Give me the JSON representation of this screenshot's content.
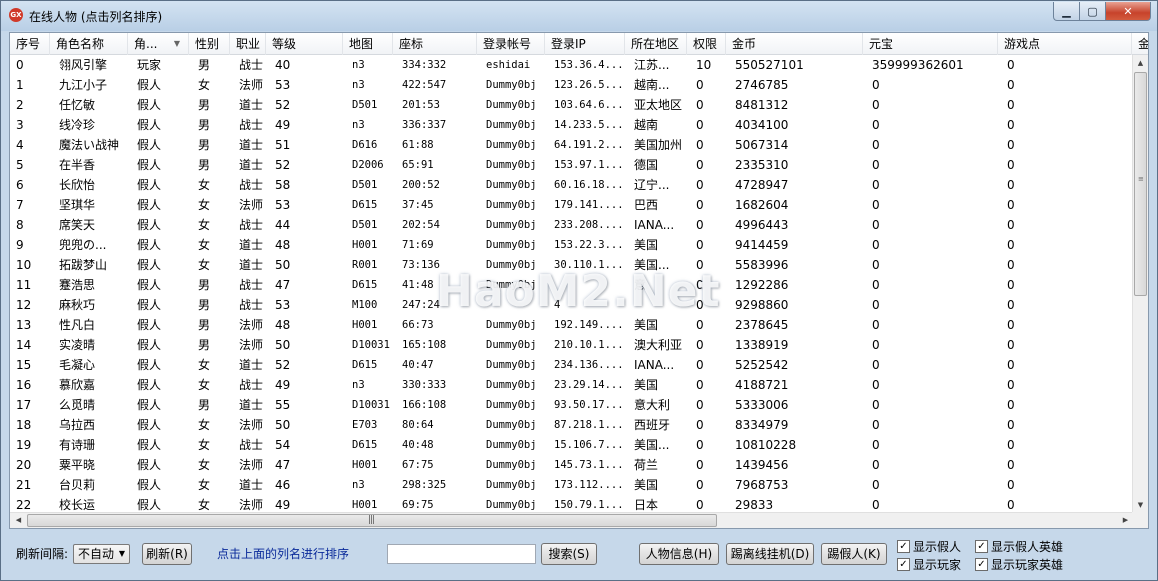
{
  "window": {
    "title": "在线人物 (点击列名排序)"
  },
  "columns": [
    {
      "key": "idx",
      "label": "序号"
    },
    {
      "key": "name",
      "label": "角色名称"
    },
    {
      "key": "role",
      "label": "角..."
    },
    {
      "key": "gender",
      "label": "性别"
    },
    {
      "key": "job",
      "label": "职业"
    },
    {
      "key": "level",
      "label": "等级"
    },
    {
      "key": "map",
      "label": "地图"
    },
    {
      "key": "coord",
      "label": "座标"
    },
    {
      "key": "account",
      "label": "登录帐号"
    },
    {
      "key": "ip",
      "label": "登录IP"
    },
    {
      "key": "region",
      "label": "所在地区"
    },
    {
      "key": "perm",
      "label": "权限"
    },
    {
      "key": "gold",
      "label": "金币"
    },
    {
      "key": "yuanbao",
      "label": "元宝"
    },
    {
      "key": "points",
      "label": "游戏点"
    },
    {
      "key": "more",
      "label": "金币"
    }
  ],
  "rows": [
    [
      "0",
      "翎风引擎",
      "玩家",
      "男",
      "战士",
      "40",
      "n3",
      "334:332",
      "eshidai",
      "153.36.4...",
      "江苏...",
      "10",
      "550527101",
      "359999362601",
      "0"
    ],
    [
      "1",
      "九江小子",
      "假人",
      "女",
      "法师",
      "53",
      "n3",
      "422:547",
      "Dummy0bj",
      "123.26.5...",
      "越南...",
      "0",
      "2746785",
      "0",
      "0"
    ],
    [
      "2",
      "任忆敏",
      "假人",
      "男",
      "道士",
      "52",
      "D501",
      "201:53",
      "Dummy0bj",
      "103.64.6...",
      "亚太地区",
      "0",
      "8481312",
      "0",
      "0"
    ],
    [
      "3",
      "线冷珍",
      "假人",
      "男",
      "战士",
      "49",
      "n3",
      "336:337",
      "Dummy0bj",
      "14.233.5...",
      "越南",
      "0",
      "4034100",
      "0",
      "0"
    ],
    [
      "4",
      "魔法い战神",
      "假人",
      "男",
      "道士",
      "51",
      "D616",
      "61:88",
      "Dummy0bj",
      "64.191.2...",
      "美国加州",
      "0",
      "5067314",
      "0",
      "0"
    ],
    [
      "5",
      "在半香",
      "假人",
      "男",
      "道士",
      "52",
      "D2006",
      "65:91",
      "Dummy0bj",
      "153.97.1...",
      "德国",
      "0",
      "2335310",
      "0",
      "0"
    ],
    [
      "6",
      "长欣怡",
      "假人",
      "女",
      "战士",
      "58",
      "D501",
      "200:52",
      "Dummy0bj",
      "60.16.18...",
      "辽宁...",
      "0",
      "4728947",
      "0",
      "0"
    ],
    [
      "7",
      "坚琪华",
      "假人",
      "女",
      "法师",
      "53",
      "D615",
      "37:45",
      "Dummy0bj",
      "179.141....",
      "巴西",
      "0",
      "1682604",
      "0",
      "0"
    ],
    [
      "8",
      "席笑天",
      "假人",
      "女",
      "战士",
      "44",
      "D501",
      "202:54",
      "Dummy0bj",
      "233.208....",
      "IANA...",
      "0",
      "4996443",
      "0",
      "0"
    ],
    [
      "9",
      "兜兜の...",
      "假人",
      "女",
      "道士",
      "48",
      "H001",
      "71:69",
      "Dummy0bj",
      "153.22.3...",
      "美国",
      "0",
      "9414459",
      "0",
      "0"
    ],
    [
      "10",
      "拓跋梦山",
      "假人",
      "女",
      "道士",
      "50",
      "R001",
      "73:136",
      "Dummy0bj",
      "30.110.1...",
      "美国...",
      "0",
      "5583996",
      "0",
      "0"
    ],
    [
      "11",
      "蹇浩思",
      "假人",
      "男",
      "战士",
      "47",
      "D615",
      "41:48",
      "Dummy0bj",
      "",
      "意",
      "0",
      "1292286",
      "0",
      "0"
    ],
    [
      "12",
      "麻秋巧",
      "假人",
      "男",
      "战士",
      "53",
      "M100",
      "247:24",
      "",
      "4",
      "",
      "0",
      "9298860",
      "0",
      "0"
    ],
    [
      "13",
      "性凡白",
      "假人",
      "男",
      "法师",
      "48",
      "H001",
      "66:73",
      "Dummy0bj",
      "192.149....",
      "美国",
      "0",
      "2378645",
      "0",
      "0"
    ],
    [
      "14",
      "实凌晴",
      "假人",
      "男",
      "法师",
      "50",
      "D10031",
      "165:108",
      "Dummy0bj",
      "210.10.1...",
      "澳大利亚",
      "0",
      "1338919",
      "0",
      "0"
    ],
    [
      "15",
      "毛凝心",
      "假人",
      "女",
      "道士",
      "52",
      "D615",
      "40:47",
      "Dummy0bj",
      "234.136....",
      "IANA...",
      "0",
      "5252542",
      "0",
      "0"
    ],
    [
      "16",
      "慕欣嘉",
      "假人",
      "女",
      "战士",
      "49",
      "n3",
      "330:333",
      "Dummy0bj",
      "23.29.14...",
      "美国",
      "0",
      "4188721",
      "0",
      "0"
    ],
    [
      "17",
      "么觅晴",
      "假人",
      "男",
      "道士",
      "55",
      "D10031",
      "166:108",
      "Dummy0bj",
      "93.50.17...",
      "意大利",
      "0",
      "5333006",
      "0",
      "0"
    ],
    [
      "18",
      "乌拉西",
      "假人",
      "女",
      "法师",
      "50",
      "E703",
      "80:64",
      "Dummy0bj",
      "87.218.1...",
      "西班牙",
      "0",
      "8334979",
      "0",
      "0"
    ],
    [
      "19",
      "有诗珊",
      "假人",
      "女",
      "战士",
      "54",
      "D615",
      "40:48",
      "Dummy0bj",
      "15.106.7...",
      "美国...",
      "0",
      "10810228",
      "0",
      "0"
    ],
    [
      "20",
      "粟平晓",
      "假人",
      "女",
      "法师",
      "47",
      "H001",
      "67:75",
      "Dummy0bj",
      "145.73.1...",
      "荷兰",
      "0",
      "1439456",
      "0",
      "0"
    ],
    [
      "21",
      "台贝莉",
      "假人",
      "女",
      "道士",
      "46",
      "n3",
      "298:325",
      "Dummy0bj",
      "173.112....",
      "美国",
      "0",
      "7968753",
      "0",
      "0"
    ],
    [
      "22",
      "校长运",
      "假人",
      "女",
      "法师",
      "49",
      "H001",
      "69:75",
      "Dummy0bj",
      "150.79.1...",
      "日本",
      "0",
      "29833",
      "0",
      "0"
    ]
  ],
  "watermark": "HaoM2.Net",
  "toolbar": {
    "refresh_interval_label": "刷新间隔:",
    "refresh_interval_value": "不自动",
    "refresh_button": "刷新(R)",
    "sort_hint": "点击上面的列名进行排序",
    "search_value": "",
    "search_button": "搜索(S)",
    "info_button": "人物信息(H)",
    "kick_afk_button": "踢离线挂机(D)",
    "kick_bot_button": "踢假人(K)",
    "show_bots": "显示假人",
    "show_players": "显示玩家",
    "show_bot_heroes": "显示假人英雄",
    "show_player_heroes": "显示玩家英雄"
  },
  "checkboxes": {
    "show_bots": true,
    "show_players": true,
    "show_bot_heroes": true,
    "show_player_heroes": true
  }
}
